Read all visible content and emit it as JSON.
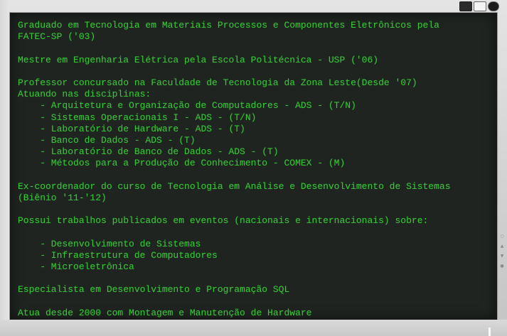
{
  "monitor": {
    "logos": [
      "energy-star-logo",
      "tco-logo",
      "power-logo"
    ],
    "side_controls": [
      "menu",
      "up",
      "down",
      "power"
    ]
  },
  "screen": {
    "lines": [
      "Graduado em Tecnologia em Materiais Processos e Componentes Eletrônicos pela",
      "FATEC-SP ('03)",
      "",
      "Mestre em Engenharia Elétrica pela Escola Politécnica - USP ('06)",
      "",
      "Professor concursado na Faculdade de Tecnologia da Zona Leste(Desde '07)",
      "Atuando nas disciplinas:",
      "    - Arquitetura e Organização de Computadores - ADS - (T/N)",
      "    - Sistemas Operacionais I - ADS - (T/N)",
      "    - Laboratório de Hardware - ADS - (T)",
      "    - Banco de Dados - ADS - (T)",
      "    - Laboratório de Banco de Dados - ADS - (T)",
      "    - Métodos para a Produção de Conhecimento - COMEX - (M)",
      "",
      "Ex-coordenador do curso de Tecnologia em Análise e Desenvolvimento de Sistemas",
      "(Biênio '11-'12)",
      "",
      "Possui trabalhos publicados em eventos (nacionais e internacionais) sobre:",
      "",
      "    - Desenvolvimento de Sistemas",
      "    - Infraestrutura de Computadores",
      "    - Microeletrônica",
      "",
      "Especialista em Desenvolvimento e Programação SQL",
      "",
      "Atua desde 2000 com Montagem e Manutenção de Hardware"
    ]
  },
  "colors": {
    "screen_bg": "#1f2420",
    "text": "#37c437",
    "bezel": "#d6d6d6"
  }
}
